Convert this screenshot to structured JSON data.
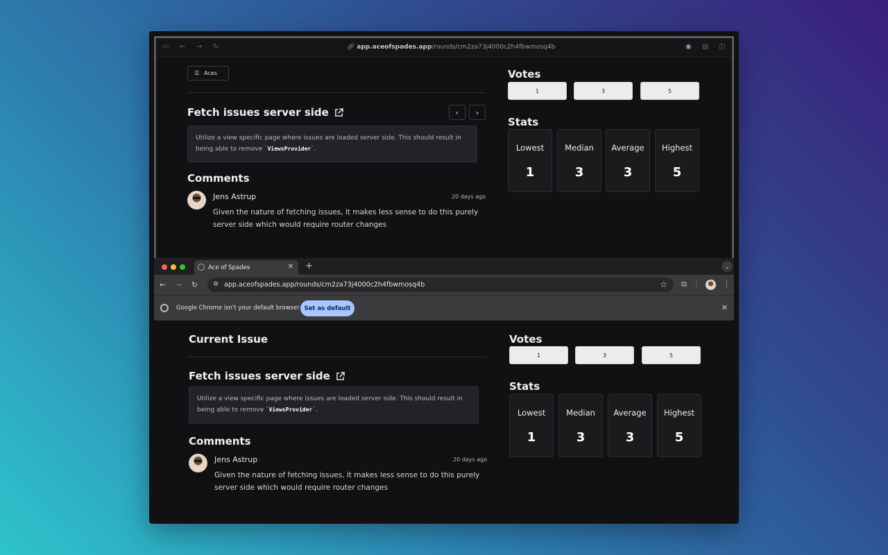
{
  "top_window": {
    "url_host": "app.aceofspades.app",
    "url_path": "/rounds/cm2za73j4000c2h4fbwmosq4b",
    "aces_button": "Aces"
  },
  "bottom_window": {
    "tab_title": "Ace of Spades",
    "url": "app.aceofspades.app/rounds/cm2za73j4000c2h4fbwmosq4b",
    "infobar_message": "Google Chrome isn't your default browser",
    "set_default_label": "Set as default",
    "current_issue_heading": "Current Issue"
  },
  "issue": {
    "title": "Fetch issues server side",
    "description_before": "Utilize a view specific page where issues are loaded server side. This should result in being able to remove `",
    "description_code": "ViewsProvider",
    "description_after": "`."
  },
  "comments": {
    "heading": "Comments",
    "items": [
      {
        "author": "Jens Astrup",
        "time": "20 days ago",
        "text": "Given the nature of fetching issues, it makes less sense to do this purely server side which would require router changes"
      }
    ]
  },
  "votes": {
    "heading": "Votes",
    "values": [
      "1",
      "3",
      "5"
    ]
  },
  "stats": {
    "heading": "Stats",
    "items": [
      {
        "label": "Lowest",
        "value": "1"
      },
      {
        "label": "Median",
        "value": "3"
      },
      {
        "label": "Average",
        "value": "3"
      },
      {
        "label": "Highest",
        "value": "5"
      }
    ]
  },
  "colors": {
    "accent_button": "#a8c7fa",
    "background": "#111113",
    "traffic_red": "#ff5f57",
    "traffic_yellow": "#febc2e",
    "traffic_green": "#28c840"
  }
}
